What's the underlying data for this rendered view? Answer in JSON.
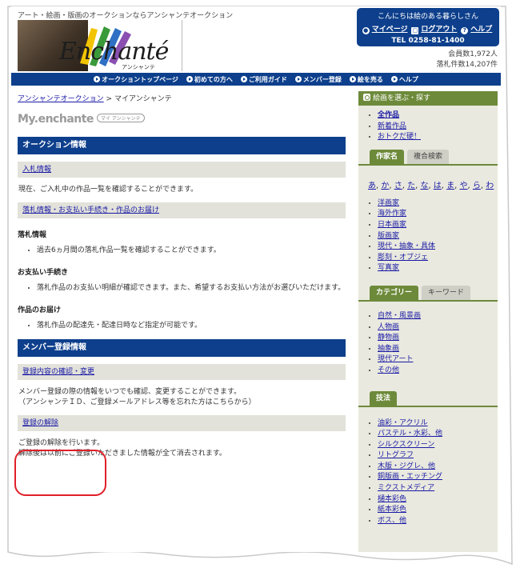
{
  "header": {
    "tagline": "アート・絵画・版画のオークションならアンシャンテオークション",
    "logo_text": "Enchanté",
    "logo_sub": "アンシャンテ",
    "greeting": "こんにちは絵のある暮らしさん",
    "mypage": "マイページ",
    "logout": "ログアウト",
    "help": "ヘルプ",
    "tel": "TEL 0258-81-1400",
    "members": "会員数1,972人",
    "winning_count": "落札件数14,207件"
  },
  "nav": [
    "オークショントップページ",
    "初めての方へ",
    "ご利用ガイド",
    "メンバー登録",
    "絵を売る",
    "ヘルプ"
  ],
  "main": {
    "breadcrumb_home": "アンシャンテオークション",
    "breadcrumb_sep": ">",
    "breadcrumb_current": "マイアンシャンテ",
    "mylogo": "My.enchante",
    "mylogo_badge": "マイ アンシャンテ",
    "auction_head": "オークション情報",
    "bid_info": "入札情報",
    "bid_desc": "現在、ご入札中の作品一覧を確認することができます。",
    "win_info": "落札情報・お支払い手続き・作品のお届け",
    "win_label": "落札情報",
    "win_item": "過去6ヵ月間の落札作品一覧を確認することができます。",
    "pay_label": "お支払い手続き",
    "pay_item": "落札作品のお支払い明細が確認できます。また、希望するお支払い方法がお選びいただけます。",
    "deliver_label": "作品のお届け",
    "deliver_item": "落札作品の配達先・配達日時など指定が可能です。",
    "member_head": "メンバー登録情報",
    "member_link": "登録内容の確認・変更",
    "member_desc1": "メンバー登録の際の情報をいつでも確認、変更することができます。",
    "member_desc2": "（アンシャンテＩＤ、ご登録メールアドレス等を忘れた方はこちらから）",
    "cancel_link": "登録の解除",
    "cancel_desc1": "ご登録の解除を行います。",
    "cancel_desc2": "解除後は以前にご登録いただきました情報が全て消去されます。"
  },
  "sidebar": {
    "head": "絵画を選ぶ・探す",
    "quick": [
      "全作品",
      "新着作品",
      "おトクだ硬！"
    ],
    "tab_artist": "作家名",
    "tab_combo": "複合検索",
    "kana": [
      "あ",
      "か",
      "さ",
      "た",
      "な",
      "は",
      "ま",
      "や",
      "ら",
      "わ"
    ],
    "genres": [
      "洋画家",
      "海外作家",
      "日本画家",
      "版画家",
      "現代・抽象・具体",
      "彫刻・オブジェ",
      "写真家"
    ],
    "tab_category": "カテゴリー",
    "tab_keyword": "キーワード",
    "categories": [
      "自然・風景画",
      "人物画",
      "静物画",
      "抽象画",
      "現代アート",
      "その他"
    ],
    "tech_head": "技法",
    "techniques": [
      "油彩・アクリル",
      "パステル・水彩、他",
      "シルクスクリーン",
      "リトグラフ",
      "木版・ジグレ、他",
      "銅版画・エッチング",
      "ミクストメディア",
      "樋本彩色",
      "紙本彩色",
      "ボス、他"
    ]
  }
}
